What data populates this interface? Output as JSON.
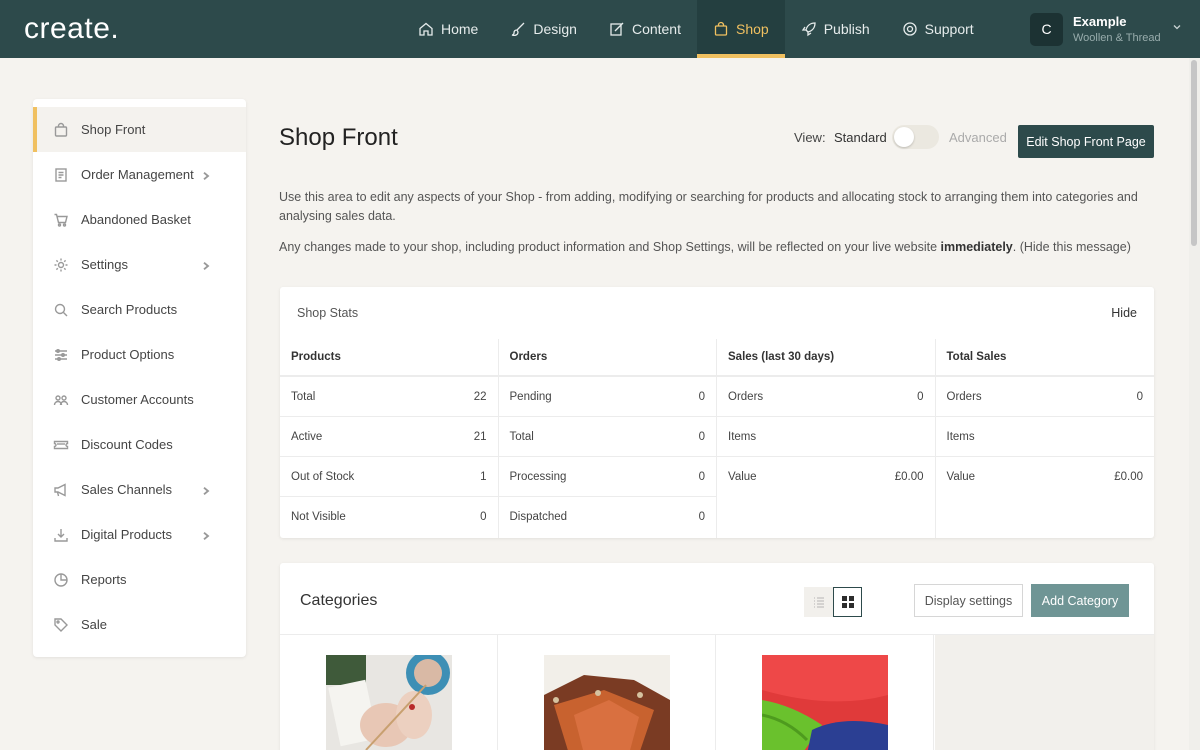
{
  "app": {
    "logo": "create."
  },
  "nav": {
    "items": [
      {
        "label": "Home",
        "icon": "home-icon"
      },
      {
        "label": "Design",
        "icon": "brush-icon"
      },
      {
        "label": "Content",
        "icon": "edit-icon"
      },
      {
        "label": "Shop",
        "icon": "shopping-bag-icon",
        "active": true
      },
      {
        "label": "Publish",
        "icon": "rocket-icon"
      },
      {
        "label": "Support",
        "icon": "lifebuoy-icon"
      }
    ]
  },
  "account": {
    "initial": "C",
    "name": "Example",
    "subtitle": "Woollen & Thread"
  },
  "sidebar": {
    "items": [
      {
        "label": "Shop Front",
        "icon": "bag-icon",
        "active": true,
        "has_children": false
      },
      {
        "label": "Order Management",
        "icon": "document-icon",
        "has_children": true
      },
      {
        "label": "Abandoned Basket",
        "icon": "cart-icon",
        "has_children": false
      },
      {
        "label": "Settings",
        "icon": "gear-icon",
        "has_children": true
      },
      {
        "label": "Search Products",
        "icon": "search-icon",
        "has_children": false
      },
      {
        "label": "Product Options",
        "icon": "sliders-icon",
        "has_children": false
      },
      {
        "label": "Customer Accounts",
        "icon": "users-icon",
        "has_children": false
      },
      {
        "label": "Discount Codes",
        "icon": "ticket-icon",
        "has_children": false
      },
      {
        "label": "Sales Channels",
        "icon": "megaphone-icon",
        "has_children": true
      },
      {
        "label": "Digital Products",
        "icon": "download-icon",
        "has_children": true
      },
      {
        "label": "Reports",
        "icon": "pie-chart-icon",
        "has_children": false
      },
      {
        "label": "Sale",
        "icon": "tag-icon",
        "has_children": false
      }
    ]
  },
  "main": {
    "title": "Shop Front",
    "view_label": "View:",
    "view_standard": "Standard",
    "view_advanced": "Advanced",
    "edit_button": "Edit Shop Front Page",
    "intro": "Use this area to edit any aspects of your Shop - from adding, modifying or searching for products and allocating stock to arranging them into categories and analysing sales data.",
    "intro2_prefix": "Any changes made to your shop, including product information and Shop Settings, will be reflected on your live website ",
    "intro2_bold": "immediately",
    "intro2_suffix": ". (Hide this message)"
  },
  "stats": {
    "title": "Shop Stats",
    "hide": "Hide",
    "columns": [
      {
        "heading": "Products",
        "rows": [
          {
            "label": "Total",
            "value": "22"
          },
          {
            "label": "Active",
            "value": "21"
          },
          {
            "label": "Out of Stock",
            "value": "1"
          },
          {
            "label": "Not Visible",
            "value": "0"
          }
        ]
      },
      {
        "heading": "Orders",
        "rows": [
          {
            "label": "Pending",
            "value": "0"
          },
          {
            "label": "Total",
            "value": "0"
          },
          {
            "label": "Processing",
            "value": "0"
          },
          {
            "label": "Dispatched",
            "value": "0"
          }
        ]
      },
      {
        "heading": "Sales (last 30 days)",
        "rows": [
          {
            "label": "Orders",
            "value": "0"
          },
          {
            "label": "Items",
            "value": ""
          },
          {
            "label": "Value",
            "value": "£0.00"
          }
        ]
      },
      {
        "heading": "Total Sales",
        "rows": [
          {
            "label": "Orders",
            "value": "0"
          },
          {
            "label": "Items",
            "value": ""
          },
          {
            "label": "Value",
            "value": "£0.00"
          }
        ]
      }
    ]
  },
  "categories": {
    "title": "Categories",
    "display_settings": "Display settings",
    "add_category": "Add Category",
    "view_mode": "grid"
  },
  "colors": {
    "nav_bg": "#2d4a4b",
    "accent": "#f0c060",
    "button_dark": "#2d4a4b",
    "button_teal": "#6f9595"
  }
}
